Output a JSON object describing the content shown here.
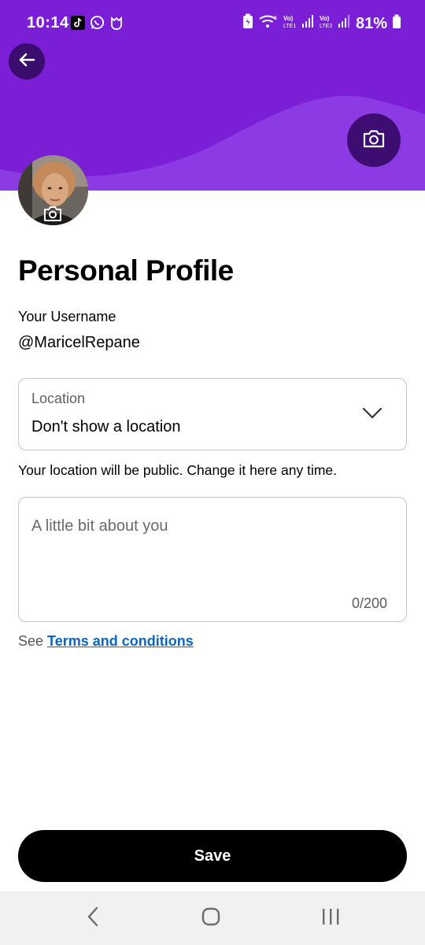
{
  "status_bar": {
    "time": "10:14",
    "battery": "81%"
  },
  "header": {
    "back_icon": "arrow-left-icon",
    "camera_icon": "camera-icon"
  },
  "profile": {
    "title": "Personal Profile",
    "username_label": "Your Username",
    "username": "@MaricelRepane"
  },
  "location": {
    "label": "Location",
    "value": "Don't show a location",
    "help": "Your location will be public. Change it here any time."
  },
  "bio": {
    "placeholder": "A little bit about you",
    "counter": "0/200"
  },
  "terms": {
    "prefix": "See",
    "link": "Terms and conditions"
  },
  "actions": {
    "save_label": "Save"
  },
  "colors": {
    "banner": "#7b1fd6",
    "link": "#0a66c2",
    "save_bg": "#000000"
  }
}
